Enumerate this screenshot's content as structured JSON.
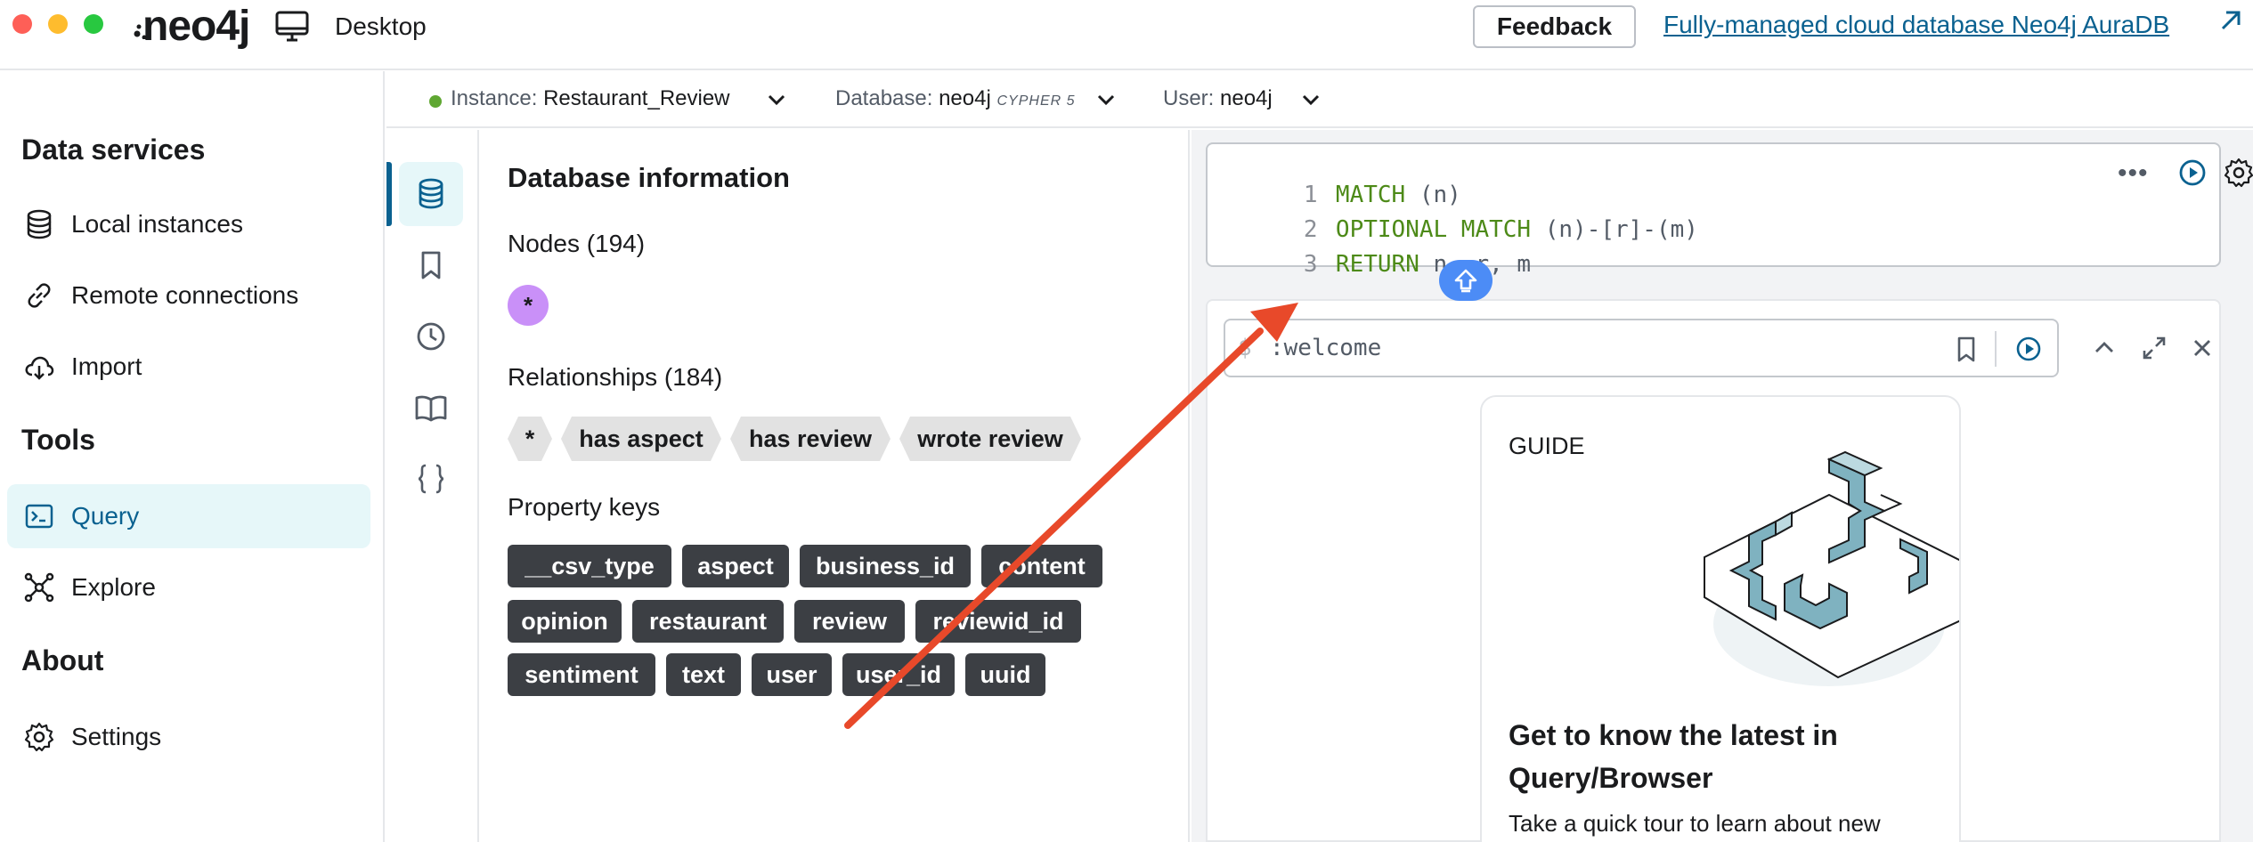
{
  "titlebar": {
    "logo": "neo4j",
    "app_label": "Desktop",
    "feedback_label": "Feedback",
    "aura_link": "Fully-managed cloud database Neo4j AuraDB"
  },
  "sidebar": {
    "sections": [
      {
        "title": "Data services"
      },
      {
        "title": "Tools"
      },
      {
        "title": "About"
      }
    ],
    "items": [
      {
        "label": "Local instances",
        "icon": "database-icon"
      },
      {
        "label": "Remote connections",
        "icon": "link-icon"
      },
      {
        "label": "Import",
        "icon": "cloud-download-icon"
      },
      {
        "label": "Query",
        "icon": "terminal-icon",
        "active": true
      },
      {
        "label": "Explore",
        "icon": "graph-icon"
      },
      {
        "label": "Settings",
        "icon": "gear-icon"
      }
    ]
  },
  "instance_bar": {
    "instance_label": "Instance:",
    "instance_value": "Restaurant_Review",
    "database_label": "Database:",
    "database_value": "neo4j",
    "database_badge": "CYPHER 5",
    "user_label": "User:",
    "user_value": "neo4j",
    "status_color": "#5fa732"
  },
  "db_info": {
    "title": "Database information",
    "nodes_heading": "Nodes (194)",
    "node_labels": [
      "*"
    ],
    "relationships_heading": "Relationships (184)",
    "relationship_types": [
      "*",
      "has aspect",
      "has review",
      "wrote review"
    ],
    "property_keys_heading": "Property keys",
    "property_keys": [
      "__csv_type",
      "aspect",
      "business_id",
      "content",
      "opinion",
      "restaurant",
      "review",
      "reviewid_id",
      "sentiment",
      "text",
      "user",
      "user_id",
      "uuid"
    ]
  },
  "editor": {
    "lines": [
      {
        "num": "1",
        "keyword": "MATCH",
        "rest": " (n)"
      },
      {
        "num": "2",
        "keyword": "OPTIONAL MATCH",
        "rest": " (n)-[r]-(m)"
      },
      {
        "num": "3",
        "keyword": "RETURN",
        "rest": " n, r, m"
      }
    ],
    "more_label": "•••"
  },
  "frame": {
    "prefix": "$",
    "command": ":welcome",
    "guide": {
      "tag": "GUIDE",
      "title": "Get to know the latest in Query/Browser",
      "body": "Take a quick tour to learn about new"
    }
  },
  "colors": {
    "accent": "#0a6190",
    "active_bg": "#e6f7f9",
    "keyword": "#4d8a18",
    "node_chip": "#c990f8",
    "arrow": "#e8492a",
    "run_blue": "#4c8cf6"
  }
}
